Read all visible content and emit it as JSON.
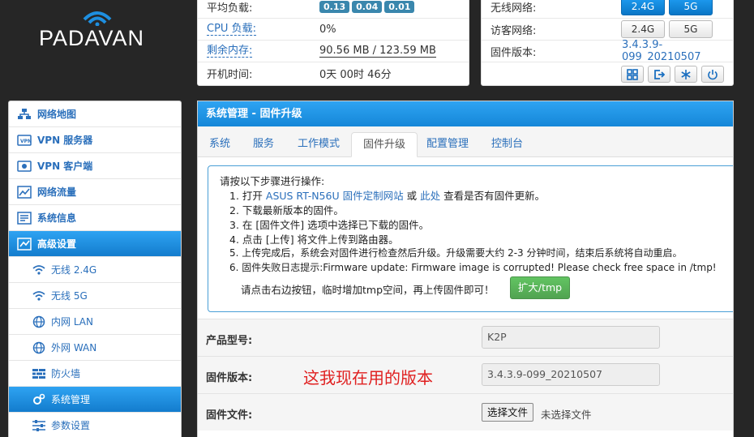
{
  "brand": {
    "logo_text": "PADAVAN"
  },
  "status_left": {
    "rows": [
      {
        "label": "平均负载:",
        "badges": [
          "0.13",
          "0.04",
          "0.01"
        ]
      },
      {
        "label": "CPU 负载:",
        "value": "0%"
      },
      {
        "label": "剩余内存:",
        "value": "90.56 MB / 123.59 MB"
      },
      {
        "label": "开机时间:",
        "value": "0天 00时 46分"
      }
    ]
  },
  "status_right": {
    "wireless_label": "无线网络:",
    "wireless_buttons": [
      "2.4G",
      "5G"
    ],
    "guest_label": "访客网络:",
    "guest_buttons": [
      "2.4G",
      "5G"
    ],
    "firmware_label": "固件版本:",
    "firmware_value": "3.4.3.9-099_20210507",
    "icon_buttons": [
      "grid-icon",
      "logout-icon",
      "snowflake-icon",
      "power-icon"
    ]
  },
  "sidebar": {
    "items": [
      {
        "label": "网络地图",
        "icon": "network-map-icon"
      },
      {
        "label": "VPN 服务器",
        "icon": "vpn-server-icon"
      },
      {
        "label": "VPN 客户端",
        "icon": "vpn-client-icon"
      },
      {
        "label": "网络流量",
        "icon": "traffic-chart-icon"
      },
      {
        "label": "系统信息",
        "icon": "system-info-icon"
      },
      {
        "label": "高级设置",
        "icon": "advanced-settings-icon"
      }
    ],
    "subitems": [
      {
        "label": "无线 2.4G",
        "icon": "wifi-icon"
      },
      {
        "label": "无线 5G",
        "icon": "wifi-icon"
      },
      {
        "label": "内网 LAN",
        "icon": "globe-icon"
      },
      {
        "label": "外网 WAN",
        "icon": "globe-icon"
      },
      {
        "label": "防火墙",
        "icon": "firewall-icon"
      },
      {
        "label": "系统管理",
        "icon": "gears-icon"
      },
      {
        "label": "参数设置",
        "icon": "sliders-icon"
      }
    ]
  },
  "main": {
    "title": "系统管理 - 固件升级",
    "tabs": [
      "系统",
      "服务",
      "工作模式",
      "固件升级",
      "配置管理",
      "控制台"
    ],
    "active_tab": "固件升级",
    "instructions": {
      "intro": "请按以下步骤进行操作:",
      "step1_prefix": "1. 打开",
      "step1_link1": "ASUS RT-N56U 固件定制网站",
      "step1_or": "或",
      "step1_link2": "此处",
      "step1_suffix": "查看是否有固件更新。",
      "step2": "2. 下载最新版本的固件。",
      "step3": "3. 在 [固件文件] 选项中选择已下载的固件。",
      "step4": "4. 点击 [上传] 将文件上传到路由器。",
      "step5": "5. 上传完成后，系统会对固件进行检查然后升级。升级需要大约 2-3 分钟时间，结束后系统将自动重启。",
      "step6": "6. 固件失败日志提示:Firmware update: Firmware image is corrupted! Please check free space in /tmp!",
      "step6_note": "请点击右边按钮，临时增加tmp空间，再上传固件即可！",
      "expand_button": "扩大/tmp"
    },
    "form": {
      "model_label": "产品型号:",
      "model_value": "K2P",
      "fw_label": "固件版本:",
      "fw_value": "3.4.3.9-099_20210507",
      "annotation": "这我现在用的版本",
      "file_label": "固件文件:",
      "file_button": "选择文件",
      "file_status": "未选择文件"
    }
  },
  "colors": {
    "accent": "#1e8fe0",
    "link": "#2a6fbb",
    "background": "#262626",
    "success": "#5cb85c",
    "annotation": "#e02020"
  }
}
